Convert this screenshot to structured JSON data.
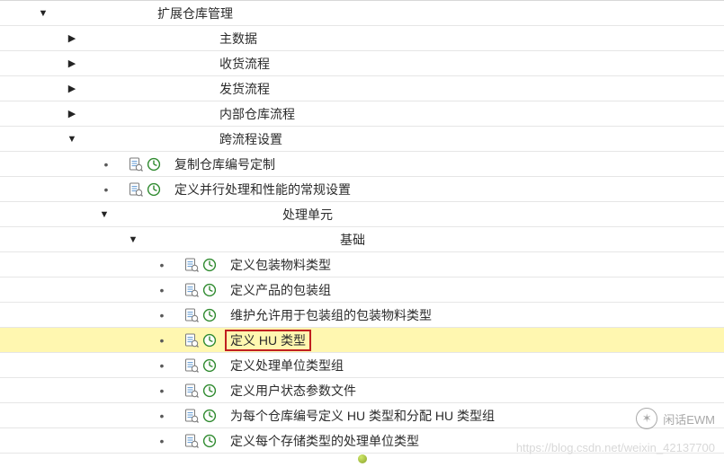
{
  "tree": {
    "n0": {
      "indent": 40,
      "marker": "down",
      "icons": false,
      "label": ""
    },
    "n1": {
      "indent": 115,
      "marker": "none",
      "icons": false,
      "label": "扩展仓库管理"
    },
    "n2": {
      "indent": 72,
      "marker": "right",
      "icons": false,
      "label": ""
    },
    "n3": {
      "indent": 152,
      "marker": "none",
      "icons": false,
      "label": "主数据"
    },
    "n4": {
      "indent": 72,
      "marker": "right",
      "icons": false,
      "label": ""
    },
    "n5": {
      "indent": 152,
      "marker": "none",
      "icons": false,
      "label": "收货流程"
    },
    "n6": {
      "indent": 72,
      "marker": "right",
      "icons": false,
      "label": ""
    },
    "n7": {
      "indent": 152,
      "marker": "none",
      "icons": false,
      "label": "发货流程"
    },
    "n8": {
      "indent": 72,
      "marker": "right",
      "icons": false,
      "label": ""
    },
    "n9": {
      "indent": 152,
      "marker": "none",
      "icons": false,
      "label": "内部仓库流程"
    },
    "n10": {
      "indent": 72,
      "marker": "down",
      "icons": false,
      "label": ""
    },
    "n11": {
      "indent": 152,
      "marker": "none",
      "icons": false,
      "label": "跨流程设置"
    },
    "n12": {
      "indent": 110,
      "marker": "dot",
      "icons": true,
      "label": "复制仓库编号定制"
    },
    "n13": {
      "indent": 110,
      "marker": "dot",
      "icons": true,
      "label": "定义并行处理和性能的常规设置"
    },
    "n14": {
      "indent": 108,
      "marker": "down",
      "icons": false,
      "label": ""
    },
    "n15": {
      "indent": 186,
      "marker": "none",
      "icons": false,
      "label": "处理单元"
    },
    "n16": {
      "indent": 140,
      "marker": "down",
      "icons": false,
      "label": ""
    },
    "n17": {
      "indent": 218,
      "marker": "none",
      "icons": false,
      "label": "基础"
    },
    "n18": {
      "indent": 172,
      "marker": "dot",
      "icons": true,
      "label": "定义包装物料类型"
    },
    "n19": {
      "indent": 172,
      "marker": "dot",
      "icons": true,
      "label": "定义产品的包装组"
    },
    "n20": {
      "indent": 172,
      "marker": "dot",
      "icons": true,
      "label": "维护允许用于包装组的包装物料类型"
    },
    "n21": {
      "indent": 172,
      "marker": "dot",
      "icons": true,
      "label": "定义 HU 类型",
      "boxed": true
    },
    "n22": {
      "indent": 172,
      "marker": "dot",
      "icons": true,
      "label": "定义处理单位类型组"
    },
    "n23": {
      "indent": 172,
      "marker": "dot",
      "icons": true,
      "label": "定义用户状态参数文件"
    },
    "n24": {
      "indent": 172,
      "marker": "dot",
      "icons": true,
      "label": "为每个仓库编号定义 HU 类型和分配 HU 类型组"
    },
    "n25": {
      "indent": 172,
      "marker": "dot",
      "icons": true,
      "label": "定义每个存储类型的处理单位类型"
    }
  },
  "rows": [
    [
      "n0",
      "n1"
    ],
    [
      "n2",
      "n3"
    ],
    [
      "n4",
      "n5"
    ],
    [
      "n6",
      "n7"
    ],
    [
      "n8",
      "n9"
    ],
    [
      "n10",
      "n11"
    ],
    [
      "n12"
    ],
    [
      "n13"
    ],
    [
      "n14",
      "n15"
    ],
    [
      "n16",
      "n17"
    ],
    [
      "n18"
    ],
    [
      "n19"
    ],
    [
      "n20"
    ],
    [
      "n21"
    ],
    [
      "n22"
    ],
    [
      "n23"
    ],
    [
      "n24"
    ],
    [
      "n25"
    ]
  ],
  "highlight_row": 13,
  "watermark": {
    "brand": "闲话EWM",
    "url": "https://blog.csdn.net/weixin_42137700"
  }
}
